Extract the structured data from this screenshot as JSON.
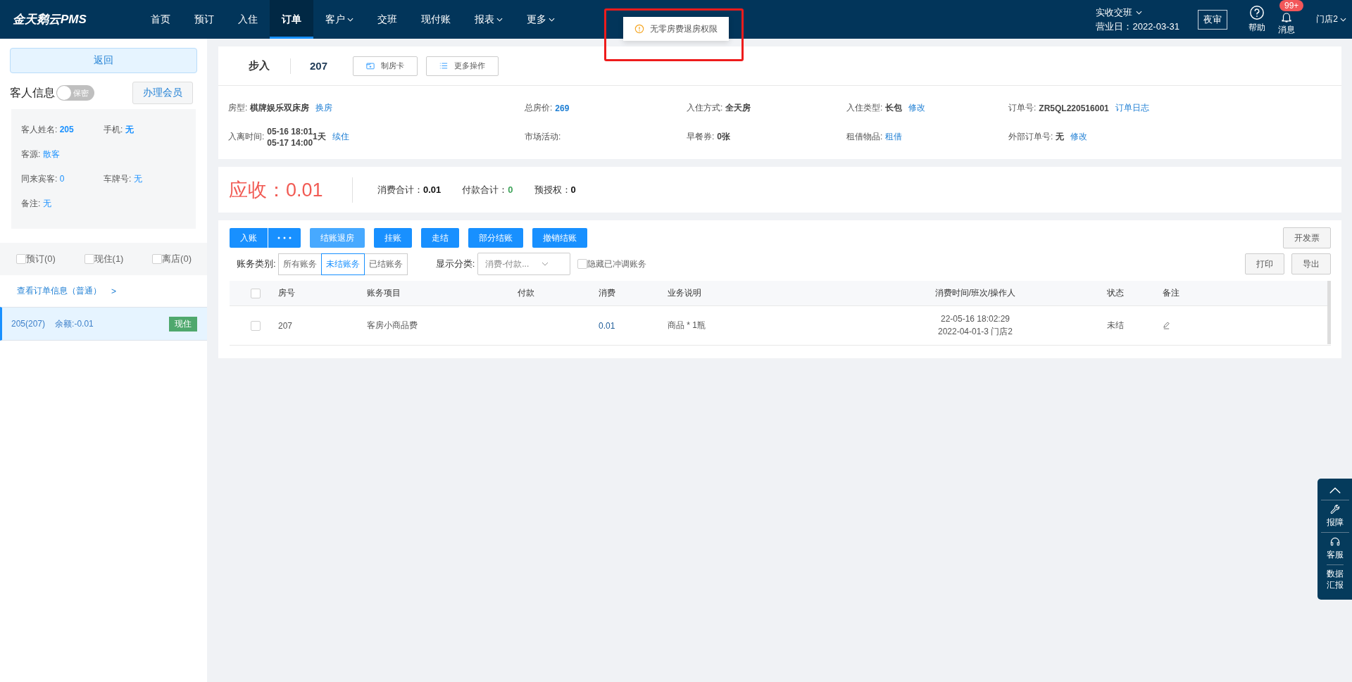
{
  "topbar": {
    "logo": "金天鹅云PMS",
    "nav": [
      {
        "label": "首页",
        "selected": false,
        "dropdown": false
      },
      {
        "label": "预订",
        "selected": false,
        "dropdown": false
      },
      {
        "label": "入住",
        "selected": false,
        "dropdown": false
      },
      {
        "label": "订单",
        "selected": true,
        "dropdown": false
      },
      {
        "label": "客户",
        "selected": false,
        "dropdown": true
      },
      {
        "label": "交班",
        "selected": false,
        "dropdown": false
      },
      {
        "label": "现付账",
        "selected": false,
        "dropdown": false
      },
      {
        "label": "报表",
        "selected": false,
        "dropdown": true
      },
      {
        "label": "更多",
        "selected": false,
        "dropdown": true
      }
    ],
    "shift": "实收交班",
    "business_date": "营业日：2022-03-31",
    "night_audit": "夜审",
    "help": "帮助",
    "messages": "消息",
    "message_badge": "99+",
    "store": "门店2"
  },
  "toast": {
    "text": "无零房费退房权限",
    "highlighted": true
  },
  "left_panel": {
    "back": "返回",
    "guest_title": "客人信息",
    "privacy": {
      "label": "保密",
      "on": false
    },
    "member_button": "办理会员",
    "guest_fields": [
      [
        {
          "label": "客人姓名:",
          "value": "205",
          "bold": true
        },
        {
          "label": "手机:",
          "value": "无",
          "bold": true
        }
      ],
      [
        {
          "label": "客源:",
          "value": "散客",
          "bold": false
        }
      ],
      [
        {
          "label": "同来宾客:",
          "value": "0",
          "bold": false
        },
        {
          "label": "车牌号:",
          "value": "无",
          "bold": false
        }
      ],
      [
        {
          "label": "备注:",
          "value": "无",
          "bold": false
        }
      ]
    ],
    "filters": [
      {
        "label": "预订(0)",
        "checked": false
      },
      {
        "label": "现住(1)",
        "checked": false
      },
      {
        "label": "离店(0)",
        "checked": false
      }
    ],
    "order_link": "查看订单信息（普通）",
    "order_link_arrow": ">",
    "rooms": [
      {
        "room": "205(207)",
        "balance": "余额:-0.01",
        "status": "现住",
        "selected": true
      }
    ]
  },
  "order": {
    "source": "步入",
    "room": "207",
    "actions": [
      {
        "label": "制房卡",
        "kind": "card"
      },
      {
        "label": "更多操作",
        "kind": "list"
      }
    ],
    "details": [
      [
        {
          "label": "房型:",
          "parts": [
            {
              "kind": "value",
              "text": "棋牌娱乐双床房"
            },
            {
              "kind": "link",
              "text": "换房"
            }
          ]
        },
        {
          "label": "总房价:",
          "parts": [
            {
              "kind": "strong_link",
              "text": "269"
            }
          ]
        },
        {
          "label": "入住方式:",
          "parts": [
            {
              "kind": "value",
              "text": "全天房"
            }
          ]
        },
        {
          "label": "入住类型:",
          "parts": [
            {
              "kind": "value",
              "text": "长包"
            },
            {
              "kind": "link",
              "text": "修改"
            }
          ]
        },
        {
          "label": "订单号:",
          "parts": [
            {
              "kind": "value",
              "text": "ZR5QL220516001"
            },
            {
              "kind": "link",
              "text": "订单日志"
            }
          ]
        }
      ],
      [
        {
          "label": "入离时间:",
          "parts": [
            {
              "kind": "stack",
              "lines": [
                "05-16 18:01",
                "05-17 14:00"
              ]
            },
            {
              "kind": "value",
              "text": "1天"
            },
            {
              "kind": "link",
              "text": "续住"
            }
          ]
        },
        {
          "label": "市场活动:"
        },
        {
          "label": "早餐券:",
          "parts": [
            {
              "kind": "value",
              "text": "0张"
            }
          ]
        },
        {
          "label": "租借物品:",
          "parts": [
            {
              "kind": "link",
              "text": "租借"
            }
          ]
        },
        {
          "label": "外部订单号:",
          "parts": [
            {
              "kind": "value",
              "text": "无"
            },
            {
              "kind": "link",
              "text": "修改"
            }
          ]
        }
      ]
    ]
  },
  "summary": {
    "receivable": "应收：0.01",
    "totals": [
      {
        "label": "消费合计：",
        "value": "0.01",
        "kind": "plain"
      },
      {
        "label": "付款合计：",
        "value": "0",
        "kind": "positive"
      },
      {
        "label": "预授权：",
        "value": "0",
        "kind": "plain"
      }
    ]
  },
  "ledger": {
    "primary_button": "入账",
    "actions": [
      {
        "label": "结账退房",
        "kind": "light"
      },
      {
        "label": "挂账",
        "kind": "solid"
      },
      {
        "label": "走结",
        "kind": "solid"
      },
      {
        "label": "部分结账",
        "kind": "solid"
      },
      {
        "label": "撤销结账",
        "kind": "solid"
      }
    ],
    "invoice": "开发票",
    "category_label": "账务类别:",
    "categories": [
      {
        "label": "所有账务",
        "selected": false
      },
      {
        "label": "未结账务",
        "selected": true
      },
      {
        "label": "已结账务",
        "selected": false
      }
    ],
    "display_label": "显示分类:",
    "display_value": "消费-付款...",
    "hide_adjusted": {
      "label": "隐藏已冲调账务",
      "checked": false
    },
    "print": "打印",
    "export": "导出",
    "table": {
      "all_checked": false,
      "columns": [
        "房号",
        "账务项目",
        "付款",
        "消费",
        "业务说明",
        "消费时间/班次/操作人",
        "状态",
        "备注"
      ],
      "rows": [
        {
          "checked": false,
          "room": "207",
          "item": "客房小商品费",
          "consumption": "0.01",
          "description": "商品 * 1瓶",
          "time": [
            "22-05-16 18:02:29",
            "2022-04-01-3 门店2"
          ],
          "status": "未结"
        }
      ]
    }
  },
  "float_tools": [
    {
      "kind": "top"
    },
    {
      "kind": "repair",
      "label": "报障"
    },
    {
      "kind": "service",
      "label": "客服"
    },
    {
      "kind": "report",
      "label": "数据汇报"
    }
  ]
}
